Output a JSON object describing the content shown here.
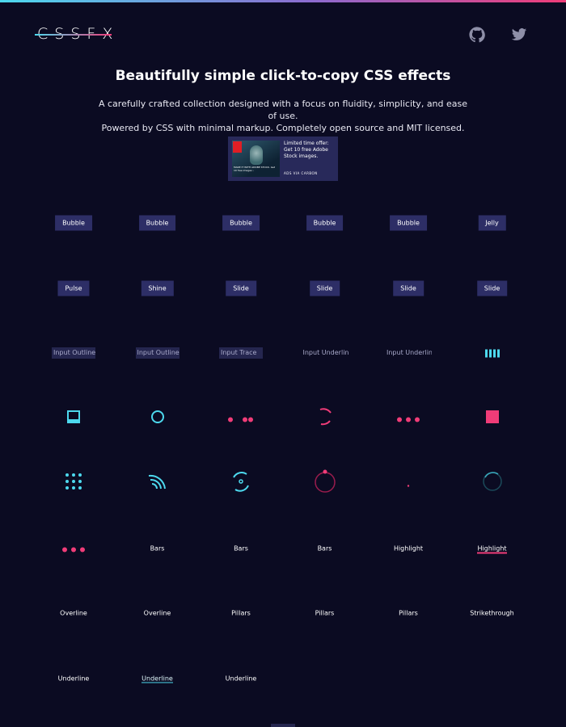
{
  "brand": {
    "logo": "CSSFX"
  },
  "header": {
    "links": [
      {
        "name": "github",
        "icon": "github-icon"
      },
      {
        "name": "twitter",
        "icon": "twitter-icon"
      }
    ]
  },
  "hero": {
    "title": "Beautifully simple click-to-copy CSS effects",
    "line1": "A carefully crafted collection designed with a focus on fluidity, simplicity, and ease of use.",
    "line2": "Powered by CSS with minimal markup. Completely open source and MIT licensed."
  },
  "ad": {
    "text": "Limited time offer: Get 10 free Adobe Stock images.",
    "caption": "MAKE IT WITH ADOBE STOCK. Get 10 free images ›",
    "via": "ADS VIA CARBON"
  },
  "effects": [
    {
      "kind": "button",
      "label": "Bubble"
    },
    {
      "kind": "button",
      "label": "Bubble"
    },
    {
      "kind": "button",
      "label": "Bubble"
    },
    {
      "kind": "button",
      "label": "Bubble"
    },
    {
      "kind": "button",
      "label": "Bubble"
    },
    {
      "kind": "button",
      "label": "Jelly"
    },
    {
      "kind": "button",
      "label": "Pulse"
    },
    {
      "kind": "button",
      "label": "Shine"
    },
    {
      "kind": "button",
      "label": "Slide"
    },
    {
      "kind": "button",
      "label": "Slide"
    },
    {
      "kind": "button",
      "label": "Slide"
    },
    {
      "kind": "button",
      "label": "Slide"
    },
    {
      "kind": "input",
      "placeholder": "Input Outline"
    },
    {
      "kind": "input",
      "placeholder": "Input Outline"
    },
    {
      "kind": "input",
      "placeholder": "Input Trace"
    },
    {
      "kind": "input-underline",
      "placeholder": "Input Underline"
    },
    {
      "kind": "input-underline",
      "placeholder": "Input Underline"
    },
    {
      "kind": "loader",
      "icon": "bars-loader-icon"
    },
    {
      "kind": "loader",
      "icon": "square-outline-loader-icon"
    },
    {
      "kind": "loader",
      "icon": "ring-loader-icon"
    },
    {
      "kind": "loader",
      "icon": "bouncing-dots-loader-icon"
    },
    {
      "kind": "loader",
      "icon": "arc-spinner-loader-icon"
    },
    {
      "kind": "loader",
      "icon": "three-dots-loader-icon"
    },
    {
      "kind": "loader",
      "icon": "square-loader-icon"
    },
    {
      "kind": "loader",
      "icon": "dot-grid-loader-icon"
    },
    {
      "kind": "loader",
      "icon": "wifi-arcs-loader-icon"
    },
    {
      "kind": "loader",
      "icon": "orbit-loader-icon"
    },
    {
      "kind": "loader",
      "icon": "circle-dot-loader-icon"
    },
    {
      "kind": "loader",
      "icon": "tiny-dot-loader-icon"
    },
    {
      "kind": "loader",
      "icon": "faint-ring-loader-icon"
    },
    {
      "kind": "loader",
      "icon": "pink-dots-loader-icon"
    },
    {
      "kind": "text",
      "label": "Bars"
    },
    {
      "kind": "text",
      "label": "Bars"
    },
    {
      "kind": "text",
      "label": "Bars"
    },
    {
      "kind": "text",
      "label": "Highlight"
    },
    {
      "kind": "text-highlight",
      "label": "Highlight"
    },
    {
      "kind": "text",
      "label": "Overline"
    },
    {
      "kind": "text",
      "label": "Overline"
    },
    {
      "kind": "text",
      "label": "Pillars"
    },
    {
      "kind": "text",
      "label": "Pillars"
    },
    {
      "kind": "text",
      "label": "Pillars"
    },
    {
      "kind": "text",
      "label": "Strikethrough"
    },
    {
      "kind": "text",
      "label": "Underline"
    },
    {
      "kind": "text-underline",
      "label": "Underline"
    },
    {
      "kind": "text",
      "label": "Underline"
    }
  ],
  "colors": {
    "background": "#0b0b22",
    "cyan": "#4dd9ee",
    "pink": "#f03c78",
    "button": "#2d2e66"
  }
}
